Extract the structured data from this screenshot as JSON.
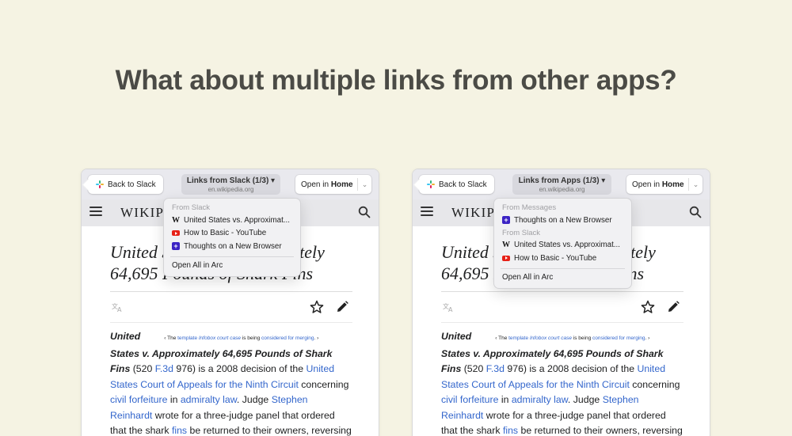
{
  "headline": "What about multiple links from other apps?",
  "windows": [
    {
      "back_label": "Back to Slack",
      "links_title": "Links from Slack (1/3) ▾",
      "links_domain": "en.wikipedia.org",
      "open_prefix": "Open in ",
      "open_target": "Home",
      "dropdown": {
        "sections": [
          {
            "title": "From Slack",
            "items": [
              {
                "icon": "wikipedia-icon",
                "label": "United States vs. Approximat..."
              },
              {
                "icon": "youtube-icon",
                "label": "How to Basic - YouTube"
              },
              {
                "icon": "arc-icon",
                "label": "Thoughts on a New Browser"
              }
            ]
          }
        ],
        "open_all": "Open All in Arc"
      }
    },
    {
      "back_label": "Back to Slack",
      "links_title": "Links from Apps (1/3) ▾",
      "links_domain": "en.wikipedia.org",
      "open_prefix": "Open in ",
      "open_target": "Home",
      "dropdown": {
        "sections": [
          {
            "title": "From Messages",
            "items": [
              {
                "icon": "arc-icon",
                "label": "Thoughts on a New Browser"
              }
            ]
          },
          {
            "title": "From Slack",
            "items": [
              {
                "icon": "wikipedia-icon",
                "label": "United States vs. Approximat..."
              },
              {
                "icon": "youtube-icon",
                "label": "How to Basic - YouTube"
              }
            ]
          }
        ],
        "open_all": "Open All in Arc"
      }
    }
  ],
  "wiki": {
    "logo": "WIKIPEDIA",
    "title_line1": "United States v. Approximately",
    "title_line2": "64,695 Pounds of Shark Fins",
    "notice_pre": "‹ The ",
    "notice_link1": "template",
    "notice_mid": " Infobox court case",
    "notice_mid2": " is being ",
    "notice_link2": "considered for merging",
    "notice_post": ". ›",
    "bold_1": "United",
    "bold_2": "States v. Approximately 64,695 Pounds of Shark Fins",
    "t1": " (520 ",
    "l1": "F.3d",
    "t2": " 976) is a 2008 decision of the ",
    "l2": "United States Court of Appeals for the Ninth Circuit",
    "t3": " concerning ",
    "l3": "civil forfeiture",
    "t4": " in ",
    "l4": "admiralty law",
    "t5": ". Judge ",
    "l5": "Stephen Reinhardt",
    "t6": " wrote for a three-judge panel that ordered that the shark ",
    "l6": "fins",
    "t7": " be returned to their owners, reversing a decision by the Southern District of California. The"
  }
}
